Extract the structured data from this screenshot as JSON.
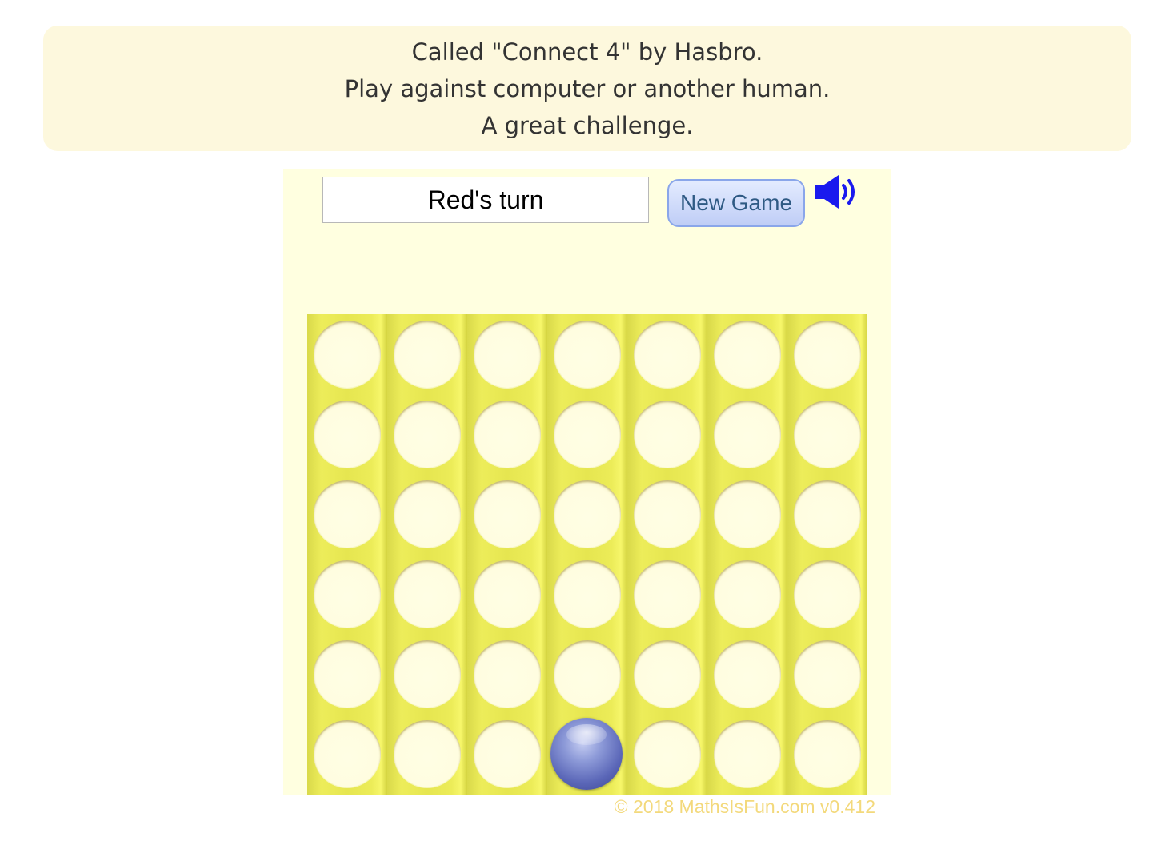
{
  "intro": {
    "line1": "Called \"Connect 4\" by Hasbro.",
    "line2": "Play against computer or another human.",
    "line3": "A great challenge."
  },
  "game": {
    "status": "Red's turn",
    "new_game_label": "New Game",
    "sound_icon": "speaker-on-icon",
    "board": {
      "columns": 7,
      "rows": 6,
      "pieces": [
        {
          "column": 4,
          "row_from_bottom": 1,
          "color": "blue"
        }
      ]
    },
    "copyright": "© 2018 MathsIsFun.com v0.412"
  },
  "colors": {
    "intro_bg": "#fdf8dd",
    "panel_bg": "#ffffe0",
    "board_yellow": "#e6e650",
    "blue_piece": "#5b67b8",
    "button_text": "#2f5a84",
    "copyright_text": "#f3d97c",
    "sound_icon": "#1a1aee"
  }
}
